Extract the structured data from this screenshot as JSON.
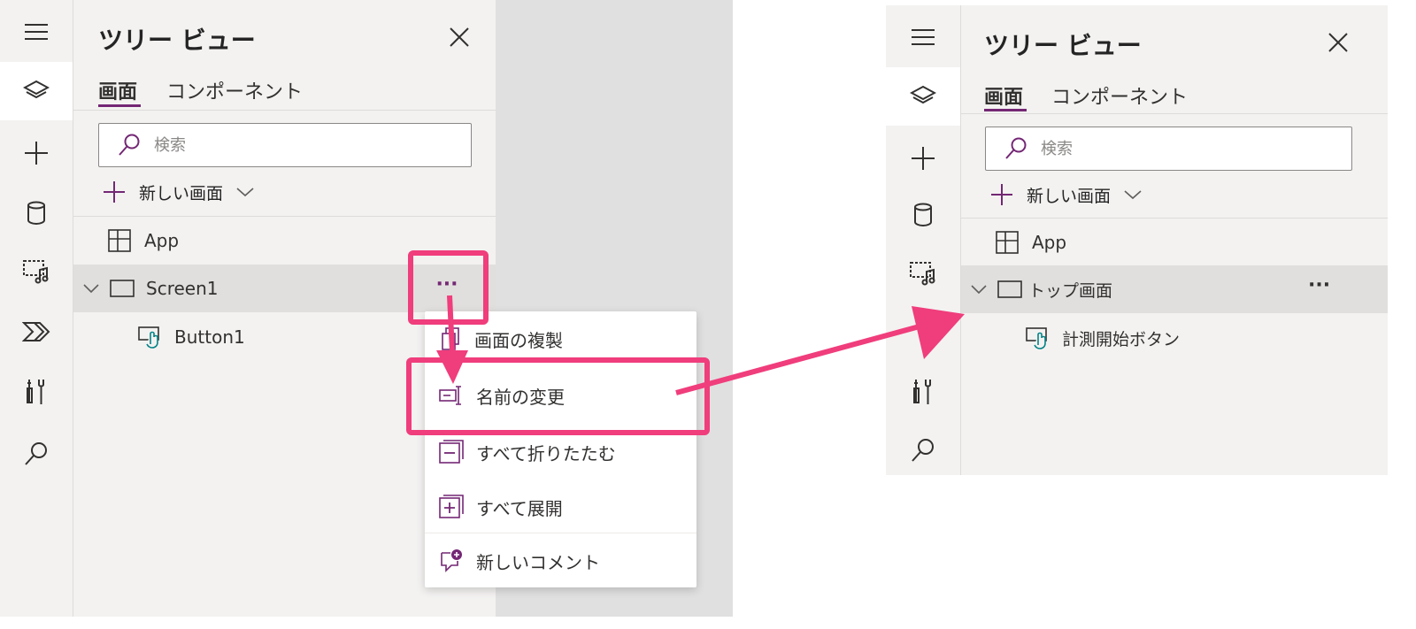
{
  "colors": {
    "accent": "#742774",
    "highlight": "#f03d7c",
    "teal": "#038387"
  },
  "left": {
    "rail_icons": [
      "hamburger-icon",
      "layers-icon",
      "plus-icon",
      "database-icon",
      "media-icon",
      "power-automate-icon",
      "tools-icon",
      "search-icon"
    ],
    "panel_title": "ツリー ビュー",
    "tabs": [
      {
        "label": "画面"
      },
      {
        "label": "コンポーネント"
      }
    ],
    "search_placeholder": "検索",
    "new_screen_label": "新しい画面",
    "tree": {
      "app_label": "App",
      "screen_label": "Screen1",
      "button_label": "Button1",
      "more_label": "···"
    },
    "context_menu": [
      {
        "label": "画面の複製",
        "icon": "duplicate-icon"
      },
      {
        "label": "名前の変更",
        "icon": "rename-icon"
      },
      {
        "label": "すべて折りたたむ",
        "icon": "collapse-all-icon"
      },
      {
        "label": "すべて展開",
        "icon": "expand-all-icon"
      },
      {
        "label": "新しいコメント",
        "icon": "new-comment-icon"
      }
    ]
  },
  "right": {
    "panel_title": "ツリー ビュー",
    "tabs": [
      {
        "label": "画面"
      },
      {
        "label": "コンポーネント"
      }
    ],
    "search_placeholder": "検索",
    "new_screen_label": "新しい画面",
    "tree": {
      "app_label": "App",
      "screen_label": "トップ画面",
      "button_label": "計測開始ボタン",
      "more_label": "···"
    }
  }
}
